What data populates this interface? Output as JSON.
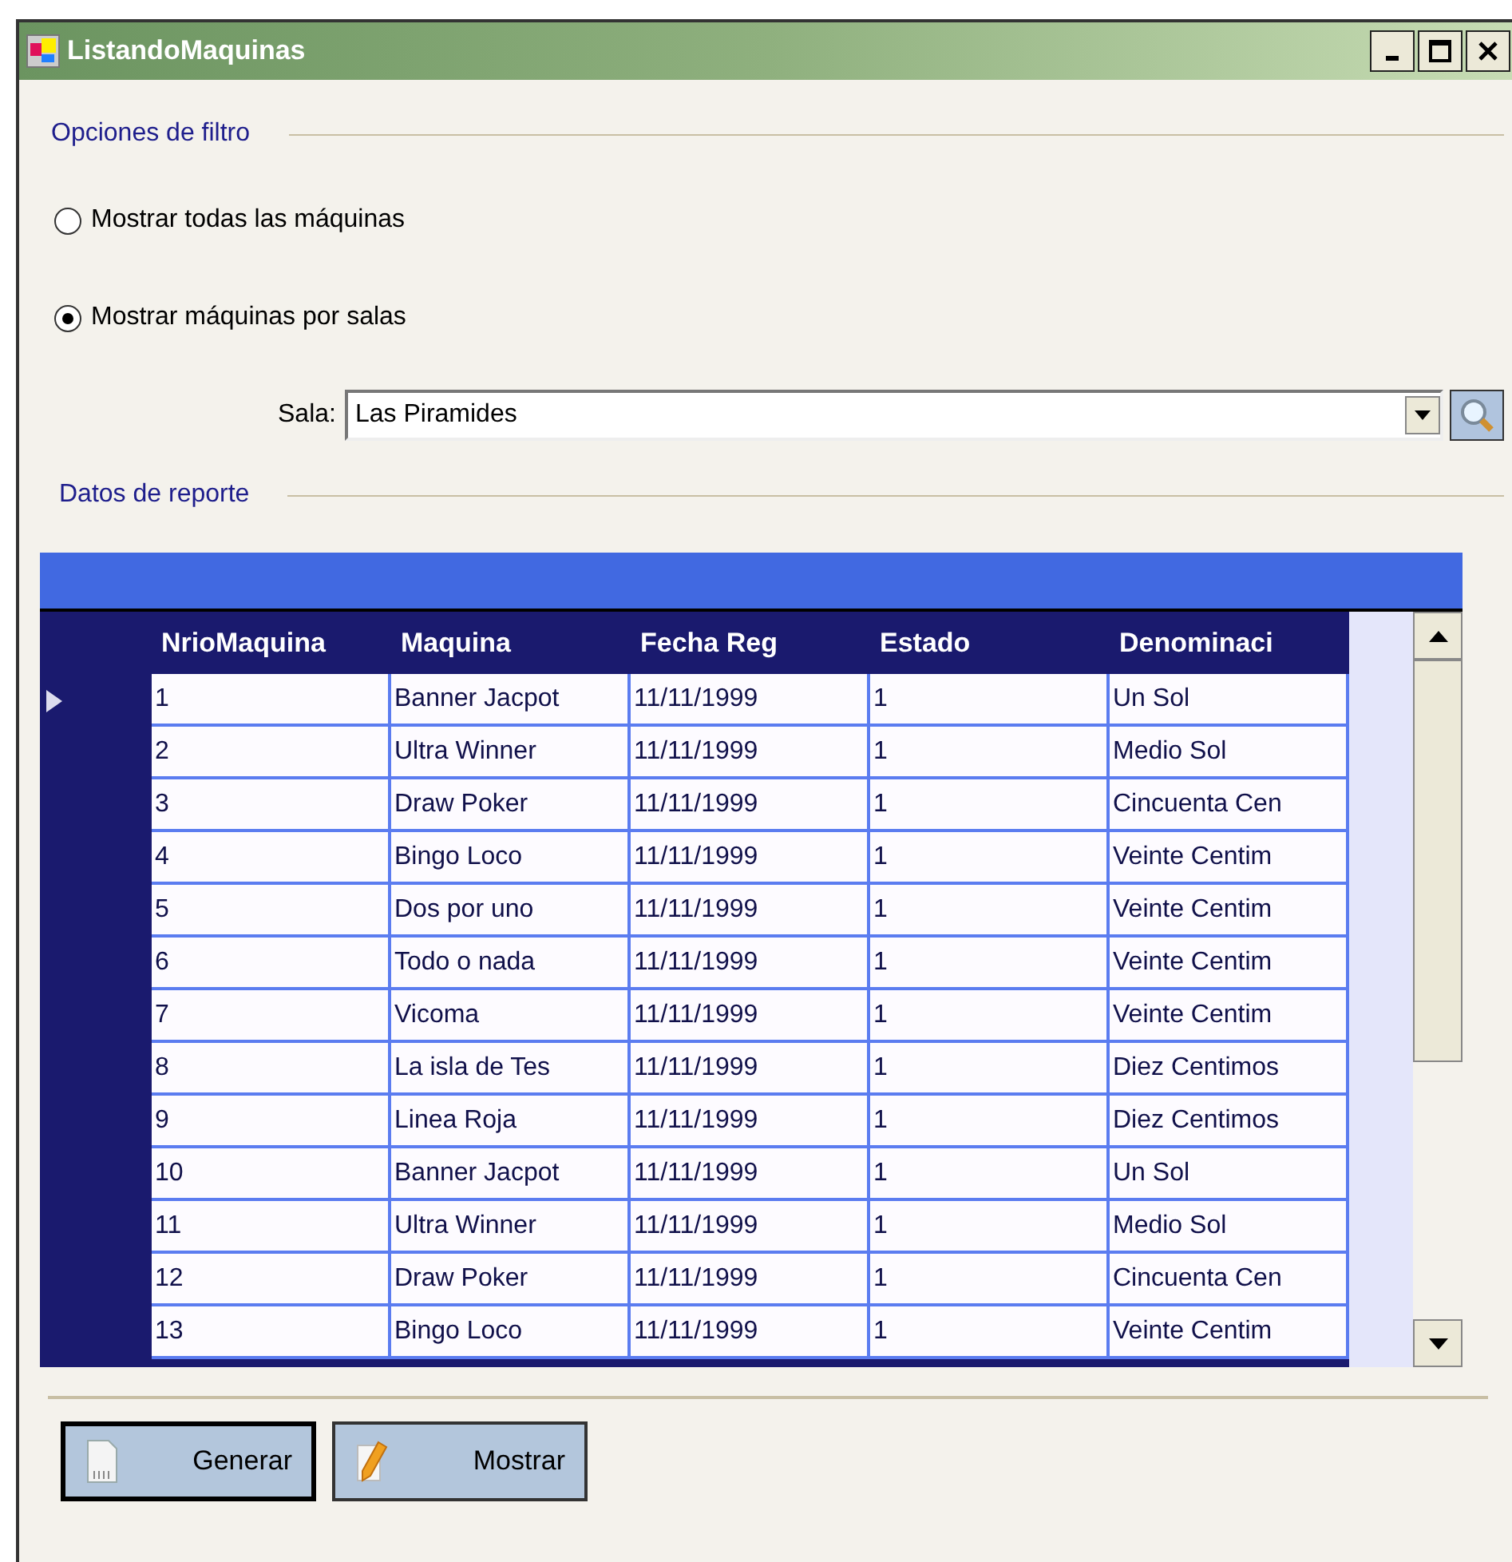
{
  "window": {
    "title": "ListandoMaquinas"
  },
  "filter_group": {
    "title": "Opciones de filtro"
  },
  "radios": [
    {
      "label": "Mostrar todas las máquinas",
      "selected": false
    },
    {
      "label": "Mostrar máquinas por salas",
      "selected": true
    }
  ],
  "sala": {
    "label": "Sala:",
    "value": "Las Piramides"
  },
  "report_group": {
    "title": "Datos de reporte"
  },
  "table": {
    "columns": [
      "NrioMaquina",
      "Maquina",
      "Fecha Reg",
      "Estado",
      "Denominaci"
    ],
    "rows": [
      {
        "cells": [
          "1",
          "Banner Jacpot",
          "11/11/1999",
          "1",
          "Un Sol"
        ],
        "selected": true
      },
      {
        "cells": [
          "2",
          "Ultra Winner",
          "11/11/1999",
          "1",
          "Medio Sol"
        ],
        "selected": false
      },
      {
        "cells": [
          "3",
          "Draw Poker",
          "11/11/1999",
          "1",
          "Cincuenta Cen"
        ],
        "selected": false
      },
      {
        "cells": [
          "4",
          "Bingo Loco",
          "11/11/1999",
          "1",
          "Veinte Centim"
        ],
        "selected": false
      },
      {
        "cells": [
          "5",
          "Dos por uno",
          "11/11/1999",
          "1",
          "Veinte Centim"
        ],
        "selected": false
      },
      {
        "cells": [
          "6",
          "Todo o nada",
          "11/11/1999",
          "1",
          "Veinte Centim"
        ],
        "selected": false
      },
      {
        "cells": [
          "7",
          "Vicoma",
          "11/11/1999",
          "1",
          "Veinte Centim"
        ],
        "selected": false
      },
      {
        "cells": [
          "8",
          "La isla de Tes",
          "11/11/1999",
          "1",
          "Diez Centimos"
        ],
        "selected": false
      },
      {
        "cells": [
          "9",
          "Linea Roja",
          "11/11/1999",
          "1",
          "Diez Centimos"
        ],
        "selected": false
      },
      {
        "cells": [
          "10",
          "Banner Jacpot",
          "11/11/1999",
          "1",
          "Un Sol"
        ],
        "selected": false
      },
      {
        "cells": [
          "11",
          "Ultra Winner",
          "11/11/1999",
          "1",
          "Medio Sol"
        ],
        "selected": false
      },
      {
        "cells": [
          "12",
          "Draw Poker",
          "11/11/1999",
          "1",
          "Cincuenta Cen"
        ],
        "selected": false
      },
      {
        "cells": [
          "13",
          "Bingo Loco",
          "11/11/1999",
          "1",
          "Veinte Centim"
        ],
        "selected": false
      }
    ]
  },
  "buttons": [
    {
      "label": "Generar",
      "kind": "generate",
      "default": true
    },
    {
      "label": "Mostrar",
      "kind": "show",
      "default": false
    }
  ]
}
